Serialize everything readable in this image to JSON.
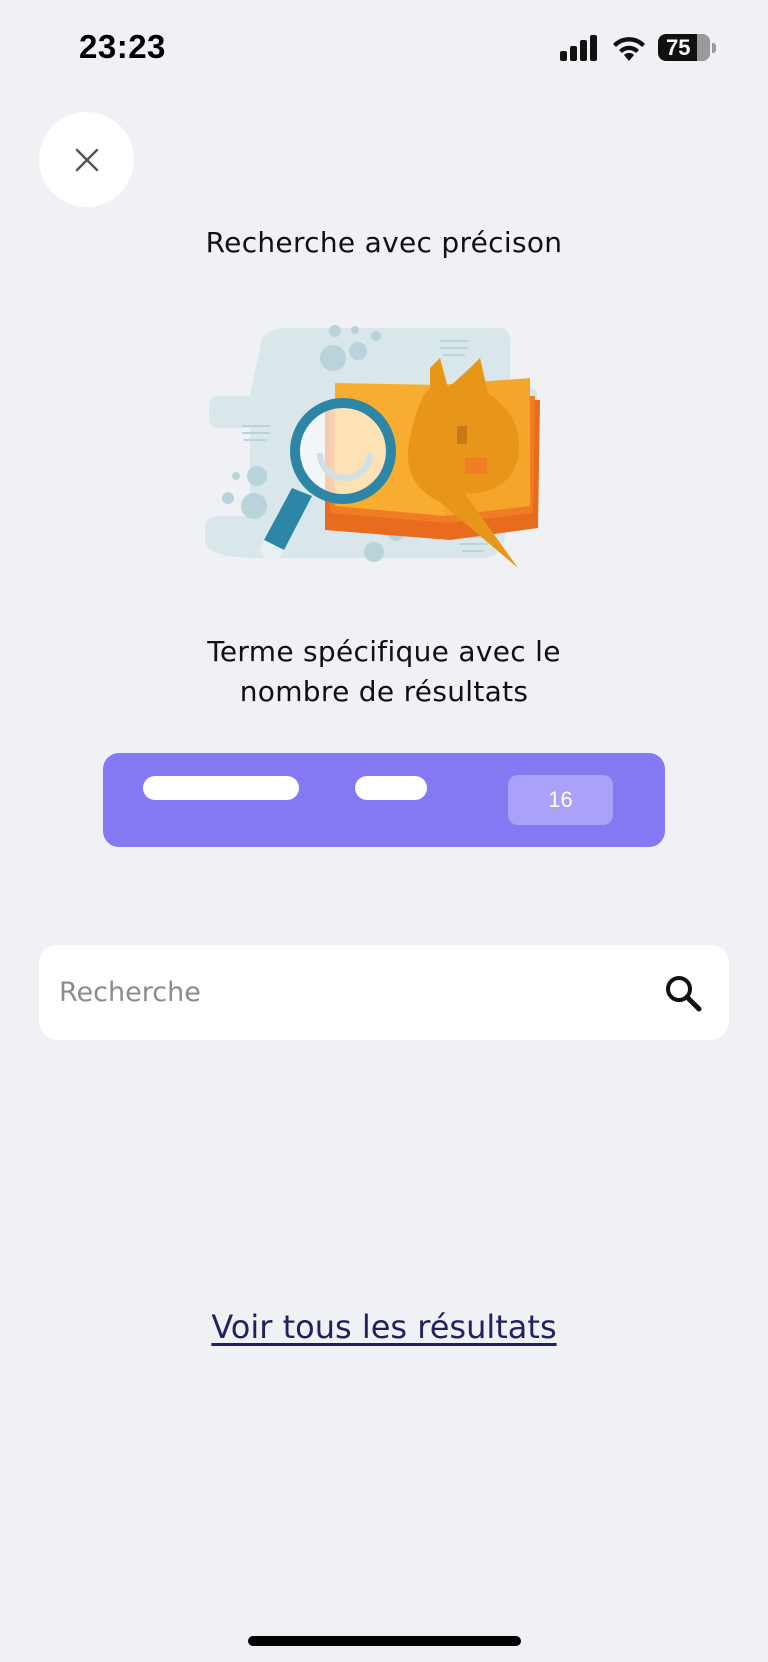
{
  "status_bar": {
    "time": "23:23",
    "battery": "75",
    "icons": [
      "signal-icon",
      "wifi-icon",
      "battery-icon"
    ]
  },
  "header": {
    "close_icon": "close-icon",
    "title": "Recherche avec précison"
  },
  "illustration": {
    "icon": "search-book-illustration"
  },
  "description": {
    "line1": "Terme spécifique avec le",
    "line2": "nombre de résultats"
  },
  "example_card": {
    "count": "16",
    "color": "#8479f3"
  },
  "search": {
    "placeholder": "Recherche",
    "value": "",
    "icon": "search-icon"
  },
  "footer": {
    "link_label": "Voir tous les résultats"
  },
  "colors": {
    "background": "#eff1f5",
    "accent": "#8479f3",
    "link": "#241f5e"
  }
}
